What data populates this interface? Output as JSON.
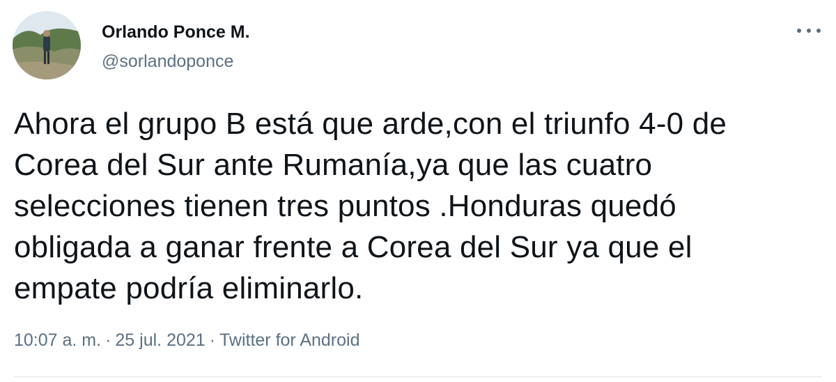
{
  "user": {
    "display_name": "Orlando Ponce M.",
    "handle": "@sorlandoponce"
  },
  "tweet": {
    "lines": [
      "Ahora el grupo B está que arde,con el triunfo 4-0 de",
      "Corea del Sur ante Rumanía,ya que las cuatro",
      "selecciones tienen tres puntos .Honduras quedó",
      "obligada a ganar frente a Corea del Sur ya que el",
      "empate podría eliminarlo."
    ]
  },
  "meta": {
    "time": "10:07 a. m.",
    "separator": "·",
    "date": "25 jul. 2021",
    "source": "Twitter for Android"
  },
  "icons": {
    "more": "more-horizontal-icon"
  },
  "colors": {
    "text_primary": "#0f1419",
    "text_secondary": "#5b7083",
    "divider": "#dfe6ea"
  }
}
